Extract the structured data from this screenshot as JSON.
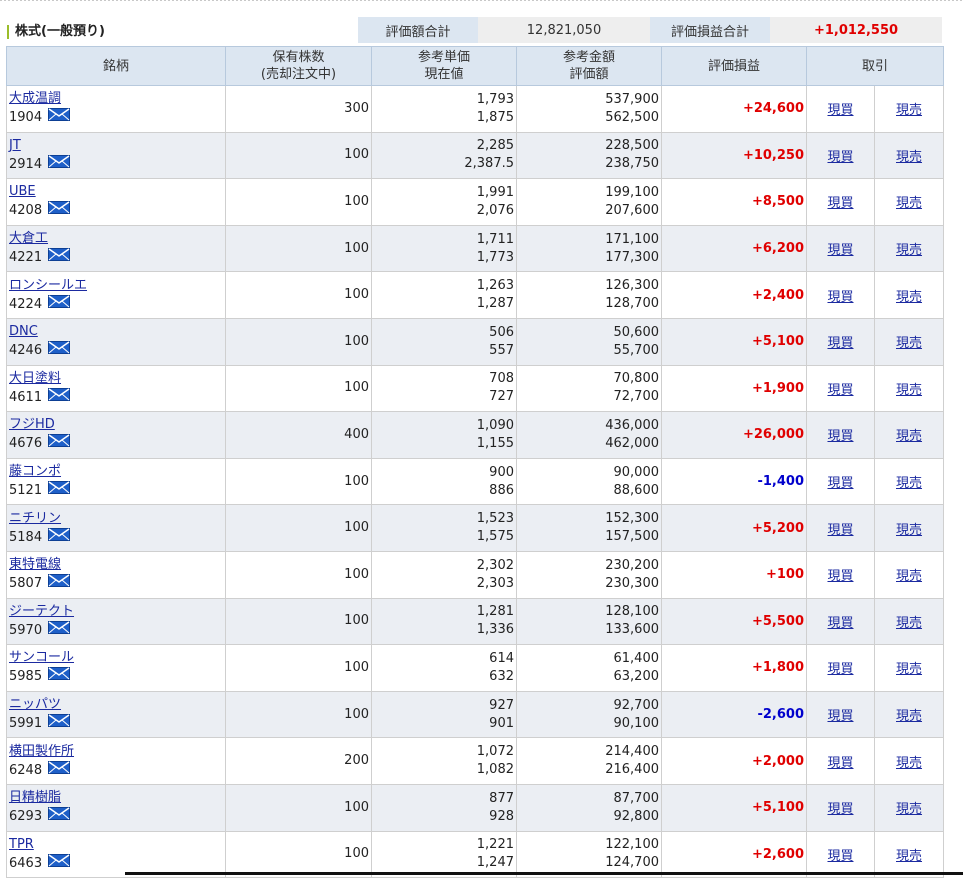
{
  "section": {
    "title": "株式(一般預り)",
    "eval_total_label": "評価額合計",
    "eval_total_value": "12,821,050",
    "pl_total_label": "評価損益合計",
    "pl_total_value": "+1,012,550"
  },
  "columns": {
    "name": "銘柄",
    "shares_1": "保有株数",
    "shares_2": "(売却注文中)",
    "price_1": "参考単価",
    "price_2": "現在値",
    "amount_1": "参考金額",
    "amount_2": "評価額",
    "pl": "評価損益",
    "trade": "取引"
  },
  "rows": [
    {
      "name": "大成温調",
      "code": "1904",
      "shares": "300",
      "unit_price": "1,793",
      "current_price": "1,875",
      "ref_amount": "537,900",
      "eval_amount": "562,500",
      "pl": "+24,600",
      "pl_sign": "pos",
      "buy": "現買",
      "sell": "現売"
    },
    {
      "name": "JT",
      "code": "2914",
      "shares": "100",
      "unit_price": "2,285",
      "current_price": "2,387.5",
      "ref_amount": "228,500",
      "eval_amount": "238,750",
      "pl": "+10,250",
      "pl_sign": "pos",
      "buy": "現買",
      "sell": "現売"
    },
    {
      "name": "UBE",
      "code": "4208",
      "shares": "100",
      "unit_price": "1,991",
      "current_price": "2,076",
      "ref_amount": "199,100",
      "eval_amount": "207,600",
      "pl": "+8,500",
      "pl_sign": "pos",
      "buy": "現買",
      "sell": "現売"
    },
    {
      "name": "大倉工",
      "code": "4221",
      "shares": "100",
      "unit_price": "1,711",
      "current_price": "1,773",
      "ref_amount": "171,100",
      "eval_amount": "177,300",
      "pl": "+6,200",
      "pl_sign": "pos",
      "buy": "現買",
      "sell": "現売"
    },
    {
      "name": "ロンシールエ",
      "code": "4224",
      "shares": "100",
      "unit_price": "1,263",
      "current_price": "1,287",
      "ref_amount": "126,300",
      "eval_amount": "128,700",
      "pl": "+2,400",
      "pl_sign": "pos",
      "buy": "現買",
      "sell": "現売"
    },
    {
      "name": "DNC",
      "code": "4246",
      "shares": "100",
      "unit_price": "506",
      "current_price": "557",
      "ref_amount": "50,600",
      "eval_amount": "55,700",
      "pl": "+5,100",
      "pl_sign": "pos",
      "buy": "現買",
      "sell": "現売"
    },
    {
      "name": "大日塗料",
      "code": "4611",
      "shares": "100",
      "unit_price": "708",
      "current_price": "727",
      "ref_amount": "70,800",
      "eval_amount": "72,700",
      "pl": "+1,900",
      "pl_sign": "pos",
      "buy": "現買",
      "sell": "現売"
    },
    {
      "name": "フジHD",
      "code": "4676",
      "shares": "400",
      "unit_price": "1,090",
      "current_price": "1,155",
      "ref_amount": "436,000",
      "eval_amount": "462,000",
      "pl": "+26,000",
      "pl_sign": "pos",
      "buy": "現買",
      "sell": "現売"
    },
    {
      "name": "藤コンポ",
      "code": "5121",
      "shares": "100",
      "unit_price": "900",
      "current_price": "886",
      "ref_amount": "90,000",
      "eval_amount": "88,600",
      "pl": "-1,400",
      "pl_sign": "neg",
      "buy": "現買",
      "sell": "現売"
    },
    {
      "name": "ニチリン",
      "code": "5184",
      "shares": "100",
      "unit_price": "1,523",
      "current_price": "1,575",
      "ref_amount": "152,300",
      "eval_amount": "157,500",
      "pl": "+5,200",
      "pl_sign": "pos",
      "buy": "現買",
      "sell": "現売"
    },
    {
      "name": "東特電線",
      "code": "5807",
      "shares": "100",
      "unit_price": "2,302",
      "current_price": "2,303",
      "ref_amount": "230,200",
      "eval_amount": "230,300",
      "pl": "+100",
      "pl_sign": "pos",
      "buy": "現買",
      "sell": "現売"
    },
    {
      "name": "ジーテクト",
      "code": "5970",
      "shares": "100",
      "unit_price": "1,281",
      "current_price": "1,336",
      "ref_amount": "128,100",
      "eval_amount": "133,600",
      "pl": "+5,500",
      "pl_sign": "pos",
      "buy": "現買",
      "sell": "現売"
    },
    {
      "name": "サンコール",
      "code": "5985",
      "shares": "100",
      "unit_price": "614",
      "current_price": "632",
      "ref_amount": "61,400",
      "eval_amount": "63,200",
      "pl": "+1,800",
      "pl_sign": "pos",
      "buy": "現買",
      "sell": "現売"
    },
    {
      "name": "ニッパツ",
      "code": "5991",
      "shares": "100",
      "unit_price": "927",
      "current_price": "901",
      "ref_amount": "92,700",
      "eval_amount": "90,100",
      "pl": "-2,600",
      "pl_sign": "neg",
      "buy": "現買",
      "sell": "現売"
    },
    {
      "name": "横田製作所",
      "code": "6248",
      "shares": "200",
      "unit_price": "1,072",
      "current_price": "1,082",
      "ref_amount": "214,400",
      "eval_amount": "216,400",
      "pl": "+2,000",
      "pl_sign": "pos",
      "buy": "現買",
      "sell": "現売"
    },
    {
      "name": "日精樹脂",
      "code": "6293",
      "shares": "100",
      "unit_price": "877",
      "current_price": "928",
      "ref_amount": "87,700",
      "eval_amount": "92,800",
      "pl": "+5,100",
      "pl_sign": "pos",
      "buy": "現買",
      "sell": "現売"
    },
    {
      "name": "TPR",
      "code": "6463",
      "shares": "100",
      "unit_price": "1,221",
      "current_price": "1,247",
      "ref_amount": "122,100",
      "eval_amount": "124,700",
      "pl": "+2,600",
      "pl_sign": "pos",
      "buy": "現買",
      "sell": "現売"
    }
  ],
  "icons": {
    "mail": "envelope-icon"
  },
  "colors": {
    "header_bg": "#dce6f1",
    "alt_row_bg": "#ebeef3",
    "positive": "#e00000",
    "negative": "#0000cc",
    "link": "#1b2aa0"
  }
}
